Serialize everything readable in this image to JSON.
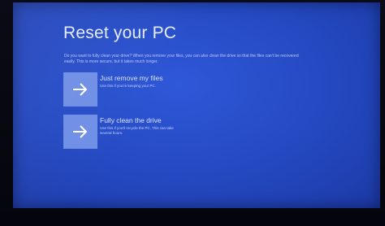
{
  "page": {
    "title": "Reset your PC",
    "description": "Do you want to fully clean your drive? When you remove your files, you can also clean the drive so that the files can't be recovered easily. This is more secure, but it takes much longer."
  },
  "options": [
    {
      "title": "Just remove my files",
      "subtitle": "Use this if you're keeping your PC.",
      "icon": "arrow-right-icon"
    },
    {
      "title": "Fully clean the drive",
      "subtitle": "Use this if you'll recycle the PC. This can take several hours.",
      "icon": "arrow-right-icon"
    }
  ],
  "colors": {
    "background": "#2448c0",
    "tile": "#6f8fe6",
    "text": "#e4ecff"
  }
}
